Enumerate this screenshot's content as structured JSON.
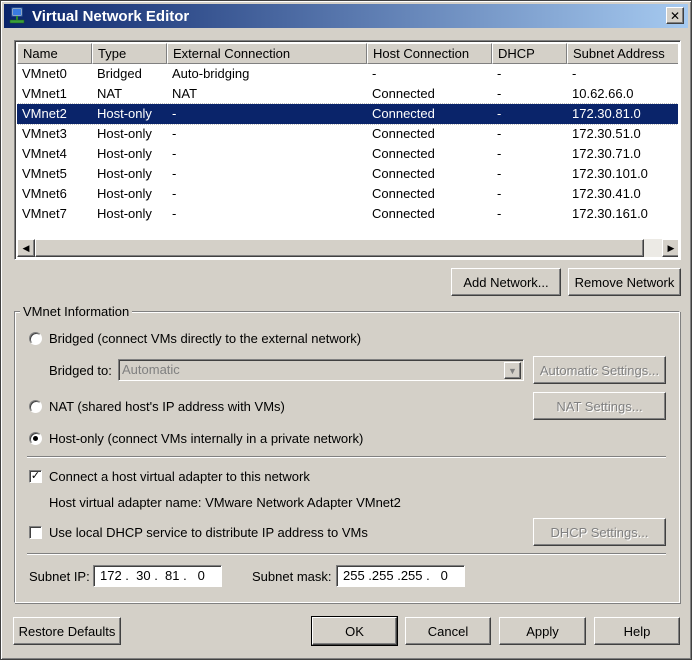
{
  "window": {
    "title": "Virtual Network Editor",
    "close": "✕"
  },
  "table": {
    "columns": [
      "Name",
      "Type",
      "External Connection",
      "Host Connection",
      "DHCP",
      "Subnet Address"
    ],
    "rows": [
      [
        "VMnet0",
        "Bridged",
        "Auto-bridging",
        "-",
        "-",
        "-"
      ],
      [
        "VMnet1",
        "NAT",
        "NAT",
        "Connected",
        "-",
        "10.62.66.0"
      ],
      [
        "VMnet2",
        "Host-only",
        "-",
        "Connected",
        "-",
        "172.30.81.0"
      ],
      [
        "VMnet3",
        "Host-only",
        "-",
        "Connected",
        "-",
        "172.30.51.0"
      ],
      [
        "VMnet4",
        "Host-only",
        "-",
        "Connected",
        "-",
        "172.30.71.0"
      ],
      [
        "VMnet5",
        "Host-only",
        "-",
        "Connected",
        "-",
        "172.30.101.0"
      ],
      [
        "VMnet6",
        "Host-only",
        "-",
        "Connected",
        "-",
        "172.30.41.0"
      ],
      [
        "VMnet7",
        "Host-only",
        "-",
        "Connected",
        "-",
        "172.30.161.0"
      ]
    ],
    "selected_index": 2
  },
  "buttons": {
    "add_network": "Add Network...",
    "remove_network": "Remove Network",
    "automatic_settings": "Automatic Settings...",
    "nat_settings": "NAT Settings...",
    "dhcp_settings": "DHCP Settings...",
    "restore_defaults": "Restore Defaults",
    "ok": "OK",
    "cancel": "Cancel",
    "apply": "Apply",
    "help": "Help"
  },
  "vmnet_info": {
    "group_label": "VMnet Information",
    "bridged_label": "Bridged (connect VMs directly to the external network)",
    "bridged_to_label": "Bridged to:",
    "bridged_to_value": "Automatic",
    "nat_label": "NAT (shared host's IP address with VMs)",
    "hostonly_label": "Host-only (connect VMs internally in a private network)",
    "selected_mode": "host-only",
    "connect_adapter_label": "Connect a host virtual adapter to this network",
    "connect_adapter_checked": true,
    "adapter_name_label": "Host virtual adapter name: VMware Network Adapter VMnet2",
    "use_dhcp_label": "Use local DHCP service to distribute IP address to VMs",
    "use_dhcp_checked": false,
    "subnet_ip_label": "Subnet IP:",
    "subnet_ip_value": "172 .  30 .  81 .   0",
    "subnet_mask_label": "Subnet mask:",
    "subnet_mask_value": "255 .255 .255 .   0"
  },
  "colors": {
    "selection": "#0a246a",
    "dialog_bg": "#d4d0c8"
  }
}
